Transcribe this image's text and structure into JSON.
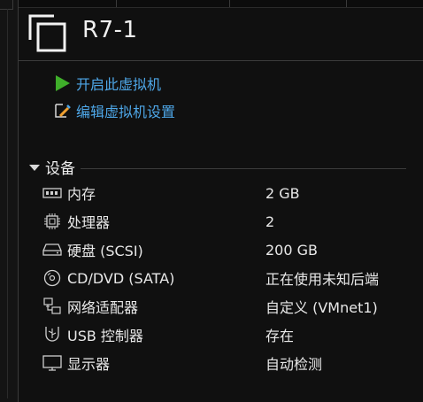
{
  "vm": {
    "name": "R7-1"
  },
  "actions": {
    "start": "开启此虚拟机",
    "edit": "编辑虚拟机设置"
  },
  "devices": {
    "section_title": "设备",
    "items": [
      {
        "icon": "memory-icon",
        "name": "内存",
        "value": "2 GB"
      },
      {
        "icon": "cpu-icon",
        "name": "处理器",
        "value": "2"
      },
      {
        "icon": "hard-disk-icon",
        "name": "硬盘 (SCSI)",
        "value": "200 GB"
      },
      {
        "icon": "cd-dvd-icon",
        "name": "CD/DVD (SATA)",
        "value": "正在使用未知后端"
      },
      {
        "icon": "network-adapter-icon",
        "name": "网络适配器",
        "value": "自定义 (VMnet1)"
      },
      {
        "icon": "usb-controller-icon",
        "name": "USB 控制器",
        "value": "存在"
      },
      {
        "icon": "display-icon",
        "name": "显示器",
        "value": "自动检测"
      }
    ]
  },
  "colors": {
    "background": "#101010",
    "link": "#4ea7e8",
    "play_green": "#3fae2a",
    "text": "#e8e8e8"
  }
}
